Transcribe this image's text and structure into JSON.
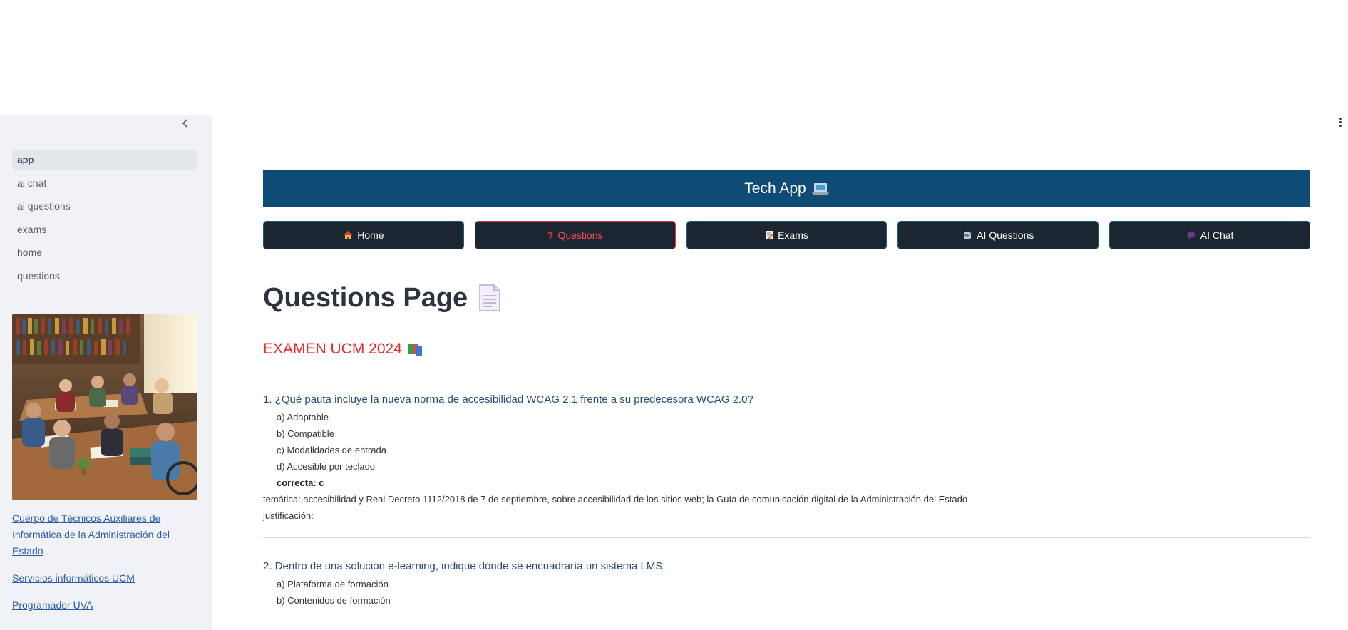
{
  "sidebar": {
    "items": [
      {
        "label": "app",
        "active": true
      },
      {
        "label": "ai chat",
        "active": false
      },
      {
        "label": "ai questions",
        "active": false
      },
      {
        "label": "exams",
        "active": false
      },
      {
        "label": "home",
        "active": false
      },
      {
        "label": "questions",
        "active": false
      }
    ],
    "links": [
      "Cuerpo de Técnicos Auxiliares de Informática de la Administración del Estado",
      "Servicios informáticos UCM",
      "Programador UVA"
    ],
    "image_icon": "people-studying-library-image"
  },
  "header": {
    "title": "Tech App",
    "title_icon": "laptop-icon"
  },
  "tabs": [
    {
      "label": "Home",
      "icon": "house-icon",
      "active": false
    },
    {
      "label": "Questions",
      "icon": "question-mark-icon",
      "active": true
    },
    {
      "label": "Exams",
      "icon": "memo-icon",
      "active": false
    },
    {
      "label": "AI Questions",
      "icon": "robot-icon",
      "active": false
    },
    {
      "label": "AI Chat",
      "icon": "speech-bubble-icon",
      "active": false
    }
  ],
  "page": {
    "title": "Questions Page",
    "title_icon": "page-icon",
    "subheader": "EXAMEN UCM 2024",
    "subheader_icon": "books-icon"
  },
  "questions": [
    {
      "title": "1. ¿Qué pauta incluye la nueva norma de accesibilidad WCAG 2.1 frente a su predecesora WCAG 2.0?",
      "options": [
        "a) Adaptable",
        "b) Compatible",
        "c) Modalidades de entrada",
        "d) Accesible por teclado"
      ],
      "correct": "correcta: c",
      "tematica": "temática: accesibilidad y Real Decreto 1112/2018 de 7 de septiembre, sobre accesibilidad de los sitios web; la Guía de comunicación digital de la Administración del Estado",
      "justificacion": "justificación:"
    },
    {
      "title": "2. Dentro de una solución e-learning, indique dónde se encuadraría un sistema LMS:",
      "options": [
        "a) Plataforma de formación",
        "b) Contenidos de formación"
      ]
    }
  ],
  "colors": {
    "banner": "#0e4c75",
    "tab_bg": "#1c2630",
    "active_tab": "#ff4b55",
    "subheader": "#e52b2b",
    "sidebar_bg": "#f0f2f6"
  }
}
